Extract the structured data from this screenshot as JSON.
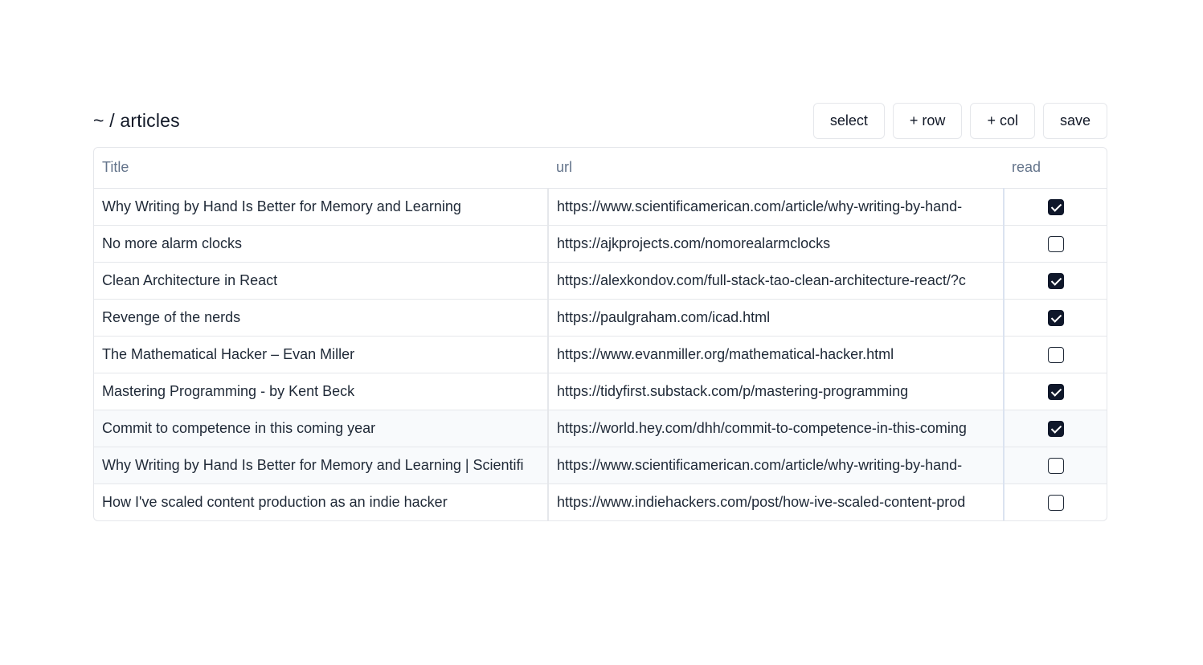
{
  "header": {
    "breadcrumb": "~ / articles",
    "buttons": {
      "select": "select",
      "add_row": "+ row",
      "add_col": "+ col",
      "save": "save"
    }
  },
  "table": {
    "columns": [
      "Title",
      "url",
      "read"
    ],
    "rows": [
      {
        "title": "Why Writing by Hand Is Better for Memory and Learning",
        "url": "https://www.scientificamerican.com/article/why-writing-by-hand-",
        "read": true
      },
      {
        "title": "No more alarm clocks",
        "url": "https://ajkprojects.com/nomorealarmclocks",
        "read": false
      },
      {
        "title": "Clean Architecture in React",
        "url": "https://alexkondov.com/full-stack-tao-clean-architecture-react/?c",
        "read": true
      },
      {
        "title": "Revenge of the nerds",
        "url": "https://paulgraham.com/icad.html",
        "read": true
      },
      {
        "title": "The Mathematical Hacker – Evan Miller",
        "url": "https://www.evanmiller.org/mathematical-hacker.html",
        "read": false
      },
      {
        "title": "Mastering Programming - by Kent Beck",
        "url": "https://tidyfirst.substack.com/p/mastering-programming",
        "read": true
      },
      {
        "title": "Commit to competence in this coming year",
        "url": "https://world.hey.com/dhh/commit-to-competence-in-this-coming",
        "read": true
      },
      {
        "title": "Why Writing by Hand Is Better for Memory and Learning | Scientifi",
        "url": "https://www.scientificamerican.com/article/why-writing-by-hand-",
        "read": false
      },
      {
        "title": "How I've scaled content production as an indie hacker",
        "url": "https://www.indiehackers.com/post/how-ive-scaled-content-prod",
        "read": false
      }
    ]
  },
  "colors": {
    "checkbox_checked": "#0f172a",
    "header_text": "#64748b",
    "border": "#e5e7eb"
  }
}
